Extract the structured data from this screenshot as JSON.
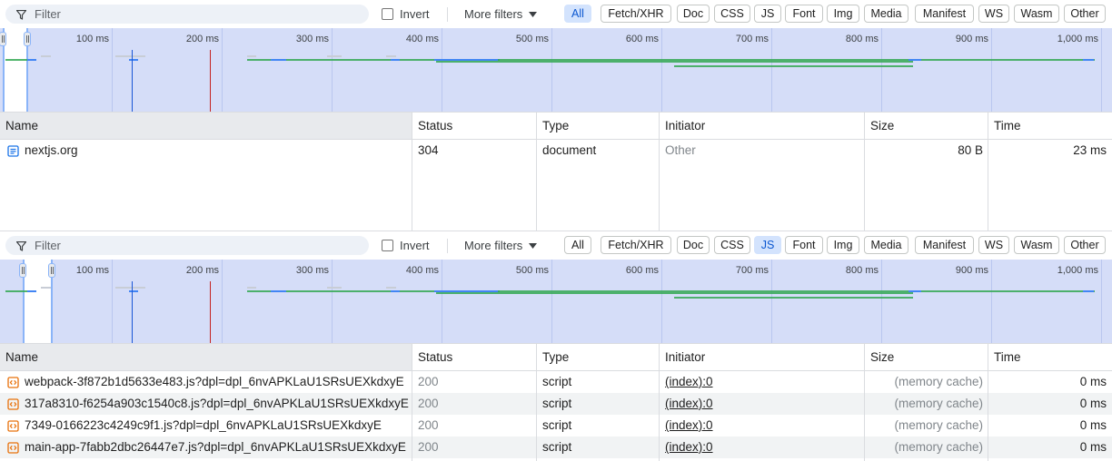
{
  "panels": [
    {
      "filter_placeholder": "Filter",
      "invert_label": "Invert",
      "more_filters_label": "More filters",
      "chips": [
        "All",
        "Fetch/XHR",
        "Doc",
        "CSS",
        "JS",
        "Font",
        "Img",
        "Media",
        "Manifest",
        "WS",
        "Wasm",
        "Other"
      ],
      "active_chip": "All",
      "ticks": [
        "100 ms",
        "200 ms",
        "300 ms",
        "400 ms",
        "500 ms",
        "600 ms",
        "700 ms",
        "800 ms",
        "900 ms",
        "1,000 ms"
      ],
      "columns": [
        "Name",
        "Status",
        "Type",
        "Initiator",
        "Size",
        "Time"
      ],
      "rows": [
        {
          "name": "nextjs.org",
          "icon": "document-icon",
          "status": "304",
          "type": "document",
          "initiator": "Other",
          "size": "80 B",
          "time": "23 ms"
        }
      ]
    },
    {
      "filter_placeholder": "Filter",
      "invert_label": "Invert",
      "more_filters_label": "More filters",
      "chips": [
        "All",
        "Fetch/XHR",
        "Doc",
        "CSS",
        "JS",
        "Font",
        "Img",
        "Media",
        "Manifest",
        "WS",
        "Wasm",
        "Other"
      ],
      "active_chip": "JS",
      "ticks": [
        "100 ms",
        "200 ms",
        "300 ms",
        "400 ms",
        "500 ms",
        "600 ms",
        "700 ms",
        "800 ms",
        "900 ms",
        "1,000 ms"
      ],
      "columns": [
        "Name",
        "Status",
        "Type",
        "Initiator",
        "Size",
        "Time"
      ],
      "rows": [
        {
          "name": "webpack-3f872b1d5633e483.js?dpl=dpl_6nvAPKLaU1SRsUEXkdxyE",
          "icon": "script-icon",
          "status": "200",
          "type": "script",
          "initiator": "(index):0",
          "size": "(memory cache)",
          "time": "0 ms"
        },
        {
          "name": "317a8310-f6254a903c1540c8.js?dpl=dpl_6nvAPKLaU1SRsUEXkdxyE",
          "icon": "script-icon",
          "status": "200",
          "type": "script",
          "initiator": "(index):0",
          "size": "(memory cache)",
          "time": "0 ms"
        },
        {
          "name": "7349-0166223c4249c9f1.js?dpl=dpl_6nvAPKLaU1SRsUEXkdxyE",
          "icon": "script-icon",
          "status": "200",
          "type": "script",
          "initiator": "(index):0",
          "size": "(memory cache)",
          "time": "0 ms"
        },
        {
          "name": "main-app-7fabb2dbc26447e7.js?dpl=dpl_6nvAPKLaU1SRsUEXkdxyE",
          "icon": "script-icon",
          "status": "200",
          "type": "script",
          "initiator": "(index):0",
          "size": "(memory cache)",
          "time": "0 ms"
        }
      ]
    }
  ],
  "colors": {
    "overview_bg": "#d5ddf8",
    "chip_active_bg": "#d3e3fd",
    "chip_active_text": "#0b57d0",
    "waterfall_green": "#34a853",
    "waterfall_blue": "#4285f4",
    "dom_content_loaded_line": "#1a56d6",
    "load_line": "#c5221f"
  }
}
